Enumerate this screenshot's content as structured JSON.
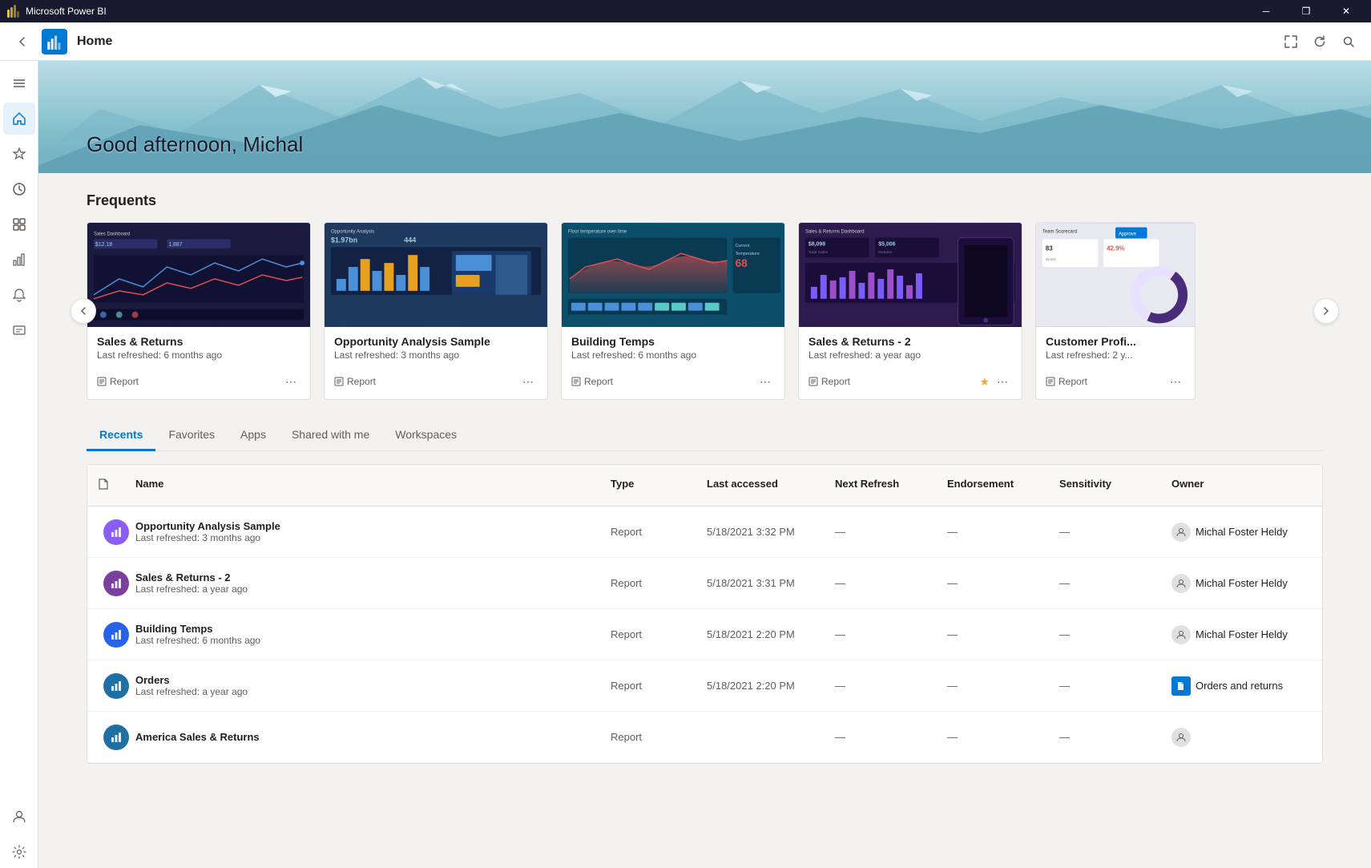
{
  "titleBar": {
    "appName": "Microsoft Power BI",
    "minimizeLabel": "─",
    "restoreLabel": "❐",
    "closeLabel": "✕"
  },
  "topNav": {
    "title": "Home",
    "backLabel": "←"
  },
  "hero": {
    "greeting": "Good afternoon, Michal"
  },
  "frequents": {
    "title": "Frequents",
    "cards": [
      {
        "title": "Sales & Returns",
        "subtitle": "Last refreshed: 6 months ago",
        "type": "Report",
        "previewClass": "preview-dark",
        "starred": false
      },
      {
        "title": "Opportunity Analysis Sample",
        "subtitle": "Last refreshed: 3 months ago",
        "type": "Report",
        "previewClass": "preview-blue",
        "starred": false
      },
      {
        "title": "Building Temps",
        "subtitle": "Last refreshed: 6 months ago",
        "type": "Report",
        "previewClass": "preview-teal",
        "starred": false
      },
      {
        "title": "Sales & Returns - 2",
        "subtitle": "Last refreshed: a year ago",
        "type": "Report",
        "previewClass": "preview-purple",
        "starred": true
      },
      {
        "title": "Customer Profi...",
        "subtitle": "Last refreshed: 2 y...",
        "type": "Report",
        "previewClass": "preview-light",
        "starred": false
      }
    ]
  },
  "recents": {
    "tabs": [
      "Recents",
      "Favorites",
      "Apps",
      "Shared with me",
      "Workspaces"
    ],
    "activeTab": "Recents",
    "columns": [
      "",
      "Name",
      "Type",
      "Last accessed",
      "Next Refresh",
      "Endorsement",
      "Sensitivity",
      "Owner"
    ],
    "rows": [
      {
        "icon": "OA",
        "iconBg": "#8B5CF6",
        "name": "Opportunity Analysis Sample",
        "subtitle": "Last refreshed: 3 months ago",
        "starred": false,
        "type": "Report",
        "lastAccessed": "5/18/2021 3:32 PM",
        "nextRefresh": "—",
        "endorsement": "—",
        "sensitivity": "—",
        "ownerType": "user",
        "owner": "Michal Foster Heldy"
      },
      {
        "icon": "SR",
        "iconBg": "#7B3FA0",
        "name": "Sales & Returns  - 2",
        "subtitle": "Last refreshed: a year ago",
        "starred": true,
        "type": "Report",
        "lastAccessed": "5/18/2021 3:31 PM",
        "nextRefresh": "—",
        "endorsement": "—",
        "sensitivity": "—",
        "ownerType": "user",
        "owner": "Michal Foster Heldy"
      },
      {
        "icon": "BT",
        "iconBg": "#2563EB",
        "name": "Building Temps",
        "subtitle": "Last refreshed: 6 months ago",
        "starred": false,
        "type": "Report",
        "lastAccessed": "5/18/2021 2:20 PM",
        "nextRefresh": "—",
        "endorsement": "—",
        "sensitivity": "—",
        "ownerType": "user",
        "owner": "Michal Foster Heldy"
      },
      {
        "icon": "OR",
        "iconBg": "#1D6FA4",
        "name": "Orders",
        "subtitle": "Last refreshed: a year ago",
        "starred": true,
        "type": "Report",
        "lastAccessed": "5/18/2021 2:20 PM",
        "nextRefresh": "—",
        "endorsement": "—",
        "sensitivity": "—",
        "ownerType": "doc",
        "owner": "Orders and returns"
      },
      {
        "icon": "AS",
        "iconBg": "#1D6FA4",
        "name": "America Sales & Returns",
        "subtitle": "",
        "starred": false,
        "type": "Report",
        "lastAccessed": "",
        "nextRefresh": "—",
        "endorsement": "—",
        "sensitivity": "—",
        "ownerType": "user",
        "owner": ""
      }
    ]
  },
  "sidebar": {
    "items": [
      {
        "icon": "☰",
        "name": "menu",
        "active": false
      },
      {
        "icon": "⌂",
        "name": "home",
        "active": true
      },
      {
        "icon": "★",
        "name": "favorites",
        "active": false
      },
      {
        "icon": "◉",
        "name": "recents",
        "active": false
      },
      {
        "icon": "⊞",
        "name": "apps",
        "active": false
      },
      {
        "icon": "📋",
        "name": "metrics",
        "active": false
      },
      {
        "icon": "🔔",
        "name": "notifications",
        "active": false
      },
      {
        "icon": "📁",
        "name": "workspaces",
        "active": false
      }
    ]
  }
}
